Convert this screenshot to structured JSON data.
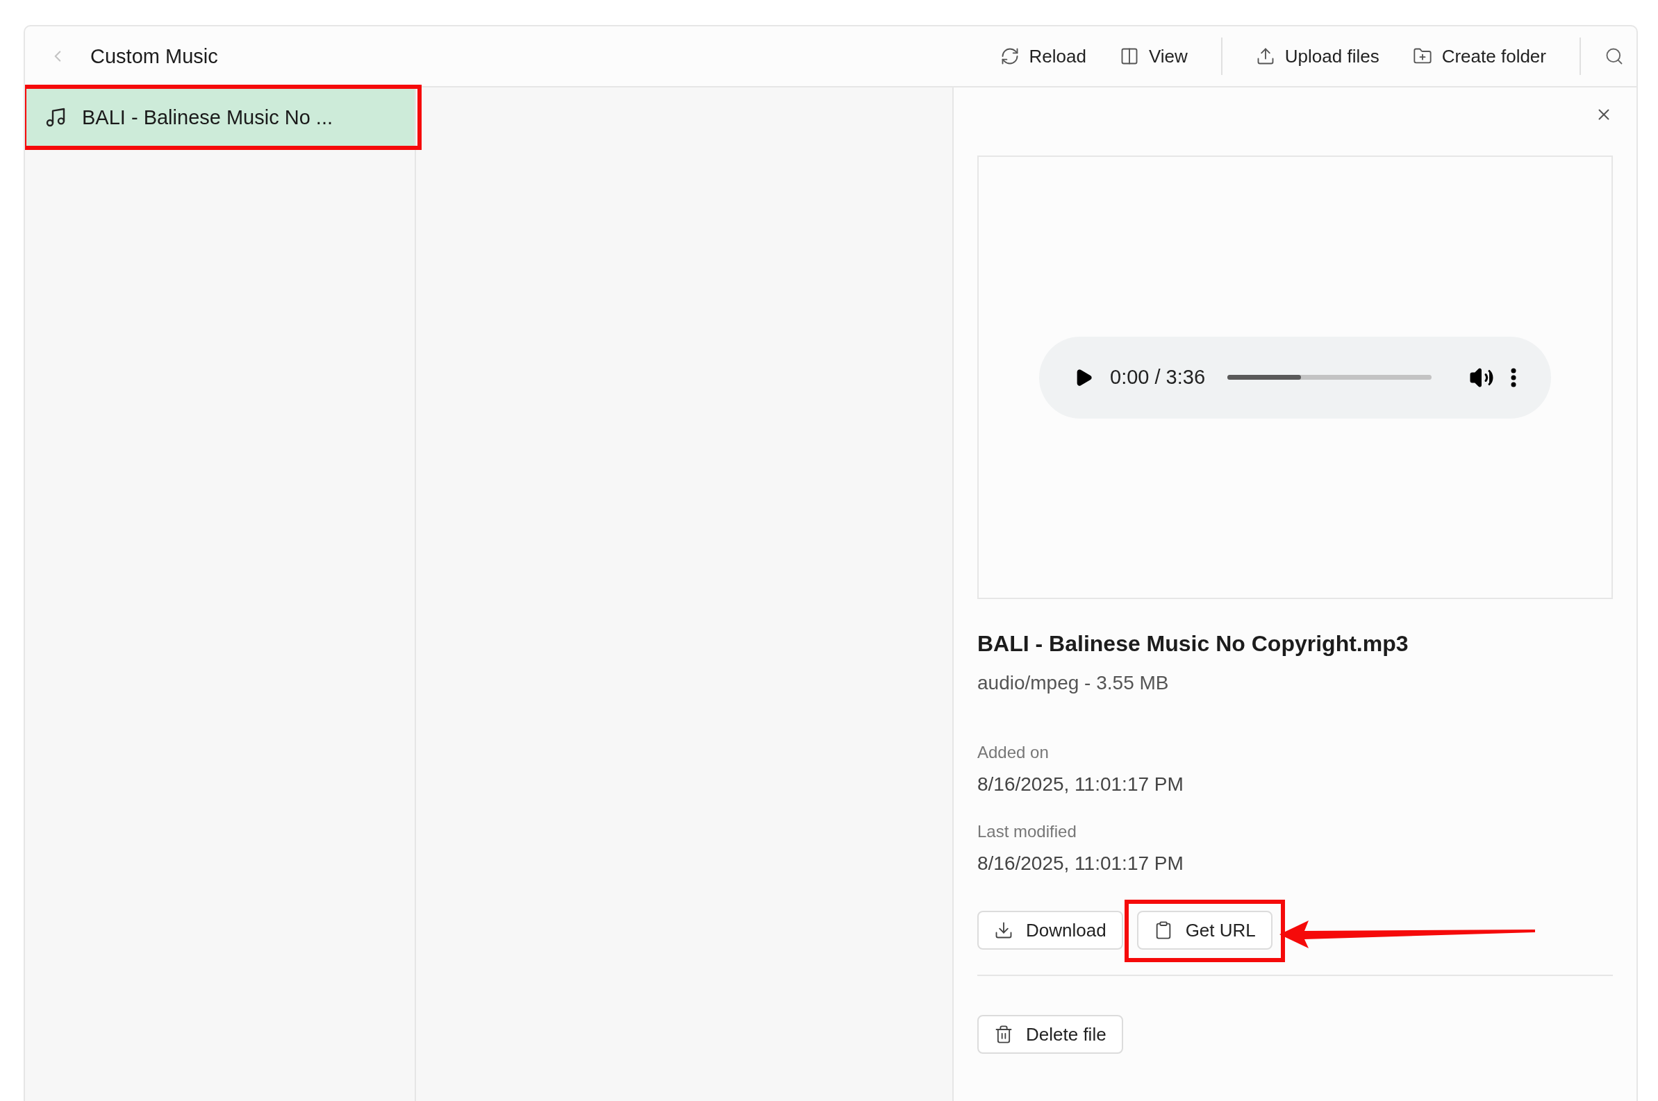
{
  "header": {
    "title": "Custom Music",
    "actions": [
      {
        "label": "Reload"
      },
      {
        "label": "View"
      },
      {
        "label": "Upload files"
      },
      {
        "label": "Create folder"
      }
    ]
  },
  "files": [
    {
      "name": "BALI - Balinese Music No ...",
      "selected": true,
      "highlighted": true
    }
  ],
  "details": {
    "player": {
      "time": "0:00 / 3:36",
      "level": 0.36
    },
    "file_name": "BALI - Balinese Music No Copyright.mp3",
    "file_info": "audio/mpeg - 3.55 MB",
    "fields": [
      {
        "label": "Added on",
        "value": "8/16/2025, 11:01:17 PM"
      },
      {
        "label": "Last modified",
        "value": "8/16/2025, 11:01:17 PM"
      }
    ],
    "actions": [
      {
        "label": "Download"
      },
      {
        "label": "Get URL",
        "highlighted": true,
        "pointed": true
      }
    ],
    "delete": {
      "label": "Delete file"
    }
  }
}
